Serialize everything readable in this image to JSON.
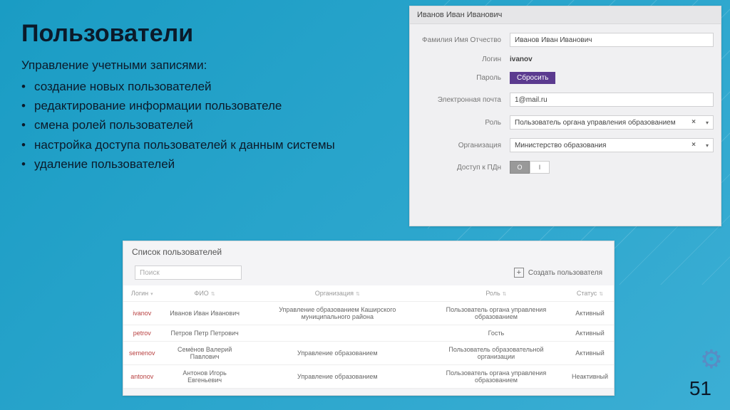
{
  "slide": {
    "title": "Пользователи",
    "subtitle": "Управление учетными записями:",
    "bullets": [
      "создание новых пользователей",
      "редактирование информации пользователе",
      "смена ролей пользователей",
      "настройка доступа пользователей к данным системы",
      "удаление пользователей"
    ],
    "page_number": "51"
  },
  "edit_form": {
    "header": "Иванов Иван Иванович",
    "labels": {
      "fio": "Фамилия Имя Отчество",
      "login": "Логин",
      "password": "Пароль",
      "email": "Электронная почта",
      "role": "Роль",
      "org": "Организация",
      "pdn": "Доступ к ПДн"
    },
    "values": {
      "fio": "Иванов Иван Иванович",
      "login": "ivanov",
      "email": "1@mail.ru",
      "role": "Пользователь органа управления образованием",
      "org": "Министерство образования"
    },
    "reset_button": "Сбросить",
    "toggle": {
      "on": "O",
      "off": "I"
    }
  },
  "user_list": {
    "title": "Список пользователей",
    "search_placeholder": "Поиск",
    "create_label": "Создать пользователя",
    "columns": {
      "login": "Логин",
      "fio": "ФИО",
      "org": "Организация",
      "role": "Роль",
      "status": "Статус"
    },
    "rows": [
      {
        "login": "ivanov",
        "fio": "Иванов Иван Иванович",
        "org": "Управление образованием Каширского муниципального района",
        "role": "Пользователь органа управления образованием",
        "status": "Активный"
      },
      {
        "login": "petrov",
        "fio": "Петров Петр Петрович",
        "org": "",
        "role": "Гость",
        "status": "Активный"
      },
      {
        "login": "semenov",
        "fio": "Семёнов Валерий Павлович",
        "org": "Управление образованием",
        "role": "Пользователь образовательной организации",
        "status": "Активный"
      },
      {
        "login": "antonov",
        "fio": "Антонов Игорь Евгеньевич",
        "org": "Управление образованием",
        "role": "Пользователь органа управления образованием",
        "status": "Неактивный"
      }
    ]
  }
}
